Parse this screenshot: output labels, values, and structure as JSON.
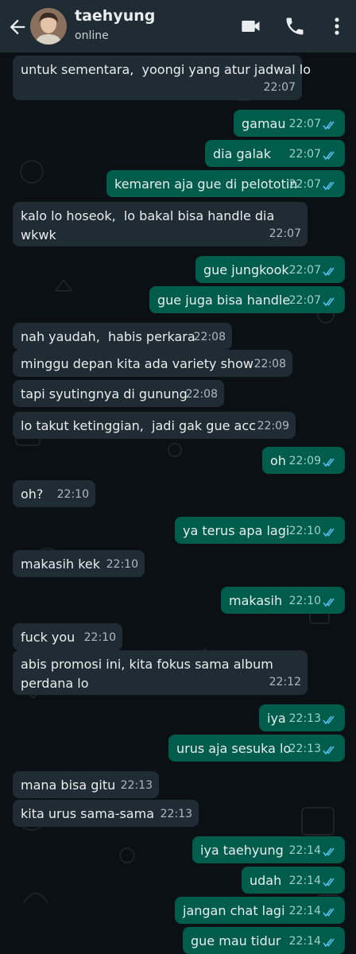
{
  "contact": {
    "name": "taehyung",
    "status": "online"
  },
  "icons": {
    "back": "arrow-left-icon",
    "video": "video-call-icon",
    "call": "phone-icon",
    "menu": "more-vert-icon"
  },
  "colors": {
    "header": "#1f2c33",
    "incoming": "#202c33",
    "outgoing": "#005c4b",
    "ticks": "#53bdeb"
  },
  "messages": [
    {
      "dir": "in",
      "text": "untuk sementara,  yoongi yang atur jadwal lo",
      "time": "22:07"
    },
    {
      "dir": "out",
      "text": "gamau",
      "time": "22:07",
      "read": true
    },
    {
      "dir": "out",
      "text": "dia galak",
      "time": "22:07",
      "read": true
    },
    {
      "dir": "out",
      "text": "kemaren aja gue di pelototin",
      "time": "22:07",
      "read": true
    },
    {
      "dir": "in",
      "text": "kalo lo hoseok,  lo bakal bisa handle dia\nwkwk",
      "time": "22:07"
    },
    {
      "dir": "out",
      "text": "gue jungkook",
      "time": "22:07",
      "read": true
    },
    {
      "dir": "out",
      "text": "gue juga bisa handle",
      "time": "22:07",
      "read": true
    },
    {
      "dir": "in",
      "text": "nah yaudah,  habis perkara",
      "time": "22:08"
    },
    {
      "dir": "in",
      "text": "minggu depan kita ada variety show",
      "time": "22:08"
    },
    {
      "dir": "in",
      "text": "tapi syutingnya di gunung",
      "time": "22:08"
    },
    {
      "dir": "in",
      "text": "lo takut ketinggian,  jadi gak gue acc",
      "time": "22:09"
    },
    {
      "dir": "out",
      "text": "oh",
      "time": "22:09",
      "read": true
    },
    {
      "dir": "in",
      "text": "oh?",
      "time": "22:10"
    },
    {
      "dir": "out",
      "text": "ya terus apa lagi",
      "time": "22:10",
      "read": true
    },
    {
      "dir": "in",
      "text": "makasih kek",
      "time": "22:10"
    },
    {
      "dir": "out",
      "text": "makasih",
      "time": "22:10",
      "read": true
    },
    {
      "dir": "in",
      "text": "fuck you",
      "time": "22:10"
    },
    {
      "dir": "in",
      "text": "abis promosi ini, kita fokus sama album\nperdana lo",
      "time": "22:12"
    },
    {
      "dir": "out",
      "text": "iya",
      "time": "22:13",
      "read": true
    },
    {
      "dir": "out",
      "text": "urus aja sesuka lo",
      "time": "22:13",
      "read": true
    },
    {
      "dir": "in",
      "text": "mana bisa gitu",
      "time": "22:13"
    },
    {
      "dir": "in",
      "text": "kita urus sama-sama",
      "time": "22:13"
    },
    {
      "dir": "out",
      "text": "iya taehyung",
      "time": "22:14",
      "read": true
    },
    {
      "dir": "out",
      "text": "udah",
      "time": "22:14",
      "read": true
    },
    {
      "dir": "out",
      "text": "jangan chat lagi",
      "time": "22:14",
      "read": true
    },
    {
      "dir": "out",
      "text": "gue mau tidur",
      "time": "22:14",
      "read": true
    }
  ]
}
